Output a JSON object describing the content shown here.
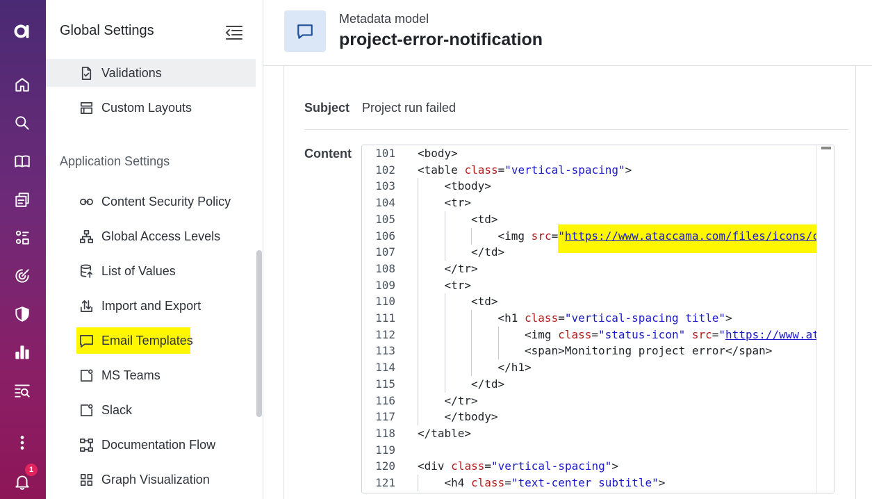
{
  "rail": {
    "logo": "ataccama-logo",
    "items": [
      "home-icon",
      "search-icon",
      "book-icon",
      "catalog-icon",
      "rules-icon",
      "target-icon",
      "shield-icon",
      "chart-icon",
      "dq-icon",
      "more-icon",
      "bell-icon"
    ],
    "notification_count": "1"
  },
  "sidebar": {
    "title": "Global Settings",
    "items_top": [
      {
        "label": "Validations",
        "icon": "validations-icon",
        "active": true
      },
      {
        "label": "Custom Layouts",
        "icon": "layouts-icon"
      }
    ],
    "section": "Application Settings",
    "items": [
      {
        "label": "Content Security Policy",
        "icon": "link-icon"
      },
      {
        "label": "Global Access Levels",
        "icon": "hierarchy-icon"
      },
      {
        "label": "List of Values",
        "icon": "database-icon"
      },
      {
        "label": "Import and Export",
        "icon": "import-export-icon"
      },
      {
        "label": "Email Templates",
        "icon": "message-icon",
        "highlighted": true
      },
      {
        "label": "MS Teams",
        "icon": "chat-window-icon"
      },
      {
        "label": "Slack",
        "icon": "chat-window-icon"
      },
      {
        "label": "Documentation Flow",
        "icon": "flow-icon"
      },
      {
        "label": "Graph Visualization",
        "icon": "grid-icon"
      }
    ]
  },
  "header": {
    "subtitle": "Metadata model",
    "title": "project-error-notification"
  },
  "form": {
    "subject_label": "Subject",
    "subject_value": "Project run failed",
    "content_label": "Content"
  },
  "editor": {
    "line_numbers": [
      "101",
      "102",
      "103",
      "104",
      "105",
      "106",
      "107",
      "108",
      "109",
      "110",
      "111",
      "112",
      "113",
      "114",
      "115",
      "116",
      "117",
      "118",
      "119",
      "120",
      "121"
    ],
    "lines": [
      {
        "indent": 0,
        "tokens": [
          [
            "tag",
            "<body>"
          ]
        ]
      },
      {
        "indent": 0,
        "tokens": [
          [
            "tag",
            "<table "
          ],
          [
            "attr",
            "class"
          ],
          [
            "tag",
            "="
          ],
          [
            "str",
            "\"vertical-spacing\""
          ],
          [
            "tag",
            ">"
          ]
        ]
      },
      {
        "indent": 1,
        "tokens": [
          [
            "tag",
            "<tbody>"
          ]
        ]
      },
      {
        "indent": 1,
        "tokens": [
          [
            "tag",
            "<tr>"
          ]
        ]
      },
      {
        "indent": 2,
        "tokens": [
          [
            "tag",
            "<td>"
          ]
        ]
      },
      {
        "indent": 3,
        "tokens": [
          [
            "tag",
            "<img "
          ],
          [
            "attr",
            "src"
          ],
          [
            "tag",
            "="
          ],
          [
            "str",
            "\""
          ],
          [
            "url",
            "https://www.ataccama.com/files/icons/com"
          ]
        ]
      },
      {
        "indent": 2,
        "tokens": [
          [
            "tag",
            "</td>"
          ]
        ]
      },
      {
        "indent": 1,
        "tokens": [
          [
            "tag",
            "</tr>"
          ]
        ]
      },
      {
        "indent": 1,
        "tokens": [
          [
            "tag",
            "<tr>"
          ]
        ]
      },
      {
        "indent": 2,
        "tokens": [
          [
            "tag",
            "<td>"
          ]
        ]
      },
      {
        "indent": 3,
        "tokens": [
          [
            "tag",
            "<h1 "
          ],
          [
            "attr",
            "class"
          ],
          [
            "tag",
            "="
          ],
          [
            "str",
            "\"vertical-spacing title\""
          ],
          [
            "tag",
            ">"
          ]
        ]
      },
      {
        "indent": 4,
        "tokens": [
          [
            "tag",
            "<img "
          ],
          [
            "attr",
            "class"
          ],
          [
            "tag",
            "="
          ],
          [
            "str",
            "\"status-icon\""
          ],
          [
            "tag",
            " "
          ],
          [
            "attr",
            "src"
          ],
          [
            "tag",
            "="
          ],
          [
            "str",
            "\""
          ],
          [
            "url",
            "https://www.atac"
          ]
        ]
      },
      {
        "indent": 4,
        "tokens": [
          [
            "tag",
            "<span>Monitoring project error</span>"
          ]
        ]
      },
      {
        "indent": 3,
        "tokens": [
          [
            "tag",
            "</h1>"
          ]
        ]
      },
      {
        "indent": 2,
        "tokens": [
          [
            "tag",
            "</td>"
          ]
        ]
      },
      {
        "indent": 1,
        "tokens": [
          [
            "tag",
            "</tr>"
          ]
        ]
      },
      {
        "indent": 1,
        "tokens": [
          [
            "tag",
            "</tbody>"
          ]
        ]
      },
      {
        "indent": 0,
        "tokens": [
          [
            "tag",
            "</table>"
          ]
        ]
      },
      {
        "indent": 0,
        "tokens": []
      },
      {
        "indent": 0,
        "tokens": [
          [
            "tag",
            "<div "
          ],
          [
            "attr",
            "class"
          ],
          [
            "tag",
            "="
          ],
          [
            "str",
            "\"vertical-spacing\""
          ],
          [
            "tag",
            ">"
          ]
        ]
      },
      {
        "indent": 1,
        "tokens": [
          [
            "tag",
            "<h4 "
          ],
          [
            "attr",
            "class"
          ],
          [
            "tag",
            "="
          ],
          [
            "str",
            "\"text-center subtitle\""
          ],
          [
            "tag",
            ">"
          ]
        ]
      }
    ]
  },
  "colors": {
    "rail_top": "#4a2a74",
    "rail_bottom": "#8d1657",
    "highlight": "#fff700",
    "header_icon_bg": "#dbe6f6"
  }
}
